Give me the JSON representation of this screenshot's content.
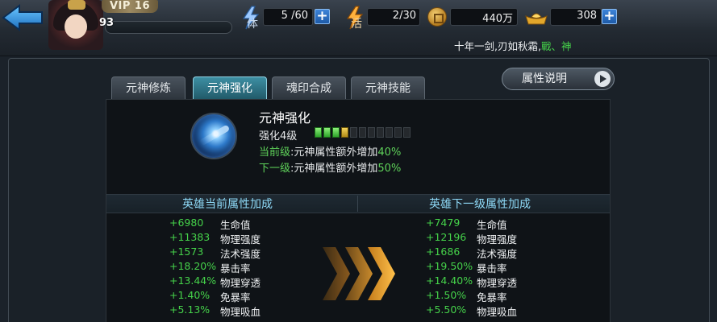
{
  "header": {
    "vip": "VIP 16",
    "level": "93",
    "resources": [
      {
        "icon": "lightning-stamina-icon",
        "label": "体",
        "value": "5 /60"
      },
      {
        "icon": "lightning-energy-icon",
        "label": "活",
        "value": "2/30"
      },
      {
        "icon": "copper-coin-icon",
        "label": "",
        "value": "440万"
      },
      {
        "icon": "gold-ingot-icon",
        "label": "",
        "value": "308"
      }
    ],
    "ticker_prefix": "十年一剑,刃如秋霜,",
    "ticker_green": "戰、神"
  },
  "tabs": [
    "元神修炼",
    "元神强化",
    "魂印合成",
    "元神技能"
  ],
  "active_tab": 1,
  "attr_button": "属性说明",
  "skill": {
    "title": "元神强化",
    "level_text": "强化4级",
    "level_pips_total": 11,
    "level_pips_on": 3,
    "level_pips_half": 1,
    "current_key": "当前级",
    "current_text": ":元神属性额外增加",
    "current_value": "40%",
    "next_key": "下一级",
    "next_text": ":元神属性额外增加",
    "next_value": "50%"
  },
  "current": {
    "header": "英雄当前属性加成",
    "rows": [
      {
        "value": "+6980",
        "name": "生命值"
      },
      {
        "value": "+11383",
        "name": "物理强度"
      },
      {
        "value": "+1573",
        "name": "法术强度"
      },
      {
        "value": "+18.20%",
        "name": "暴击率"
      },
      {
        "value": "+13.44%",
        "name": "物理穿透"
      },
      {
        "value": "+1.40%",
        "name": "免暴率"
      },
      {
        "value": "+5.13%",
        "name": "物理吸血"
      }
    ]
  },
  "next": {
    "header": "英雄下一级属性加成",
    "rows": [
      {
        "value": "+7479",
        "name": "生命值"
      },
      {
        "value": "+12196",
        "name": "物理强度"
      },
      {
        "value": "+1686",
        "name": "法术强度"
      },
      {
        "value": "+19.50%",
        "name": "暴击率"
      },
      {
        "value": "+14.40%",
        "name": "物理穿透"
      },
      {
        "value": "+1.50%",
        "name": "免暴率"
      },
      {
        "value": "+5.50%",
        "name": "物理吸血"
      }
    ]
  },
  "colors": {
    "green": "#45d24a",
    "cyan": "#8ed9f7",
    "active_tab": "#2f7f93"
  }
}
